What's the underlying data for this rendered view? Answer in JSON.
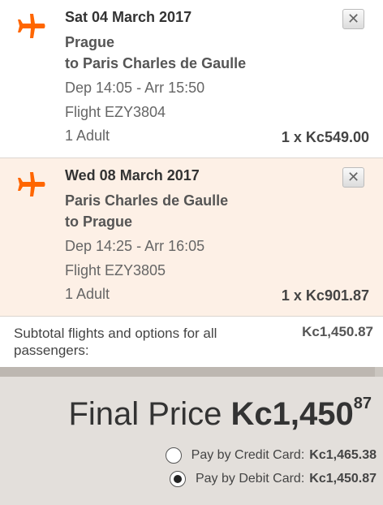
{
  "accent_color": "#ff6600",
  "flights": [
    {
      "date": "Sat 04 March 2017",
      "from": "Prague",
      "to": "to Paris Charles de Gaulle",
      "times": "Dep 14:05 - Arr 15:50",
      "flight_no": "Flight EZY3804",
      "passengers": "1 Adult",
      "price": "1 x Kc549.00",
      "remove_label": "✕",
      "icon": "plane-icon"
    },
    {
      "date": "Wed 08 March 2017",
      "from": "Paris Charles de Gaulle",
      "to": "to Prague",
      "times": "Dep 14:25 - Arr 16:05",
      "flight_no": "Flight EZY3805",
      "passengers": "1 Adult",
      "price": "1 x Kc901.87",
      "remove_label": "✕",
      "icon": "plane-icon"
    }
  ],
  "subtotal": {
    "label": "Subtotal flights and options for all passengers:",
    "value": "Kc1,450.87"
  },
  "final_price": {
    "label": "Final Price",
    "amount": "Kc1,450",
    "cents": "87"
  },
  "payment": {
    "credit": {
      "label": "Pay by Credit Card:",
      "amount": "Kc1,465.38",
      "selected": false
    },
    "debit": {
      "label": "Pay by Debit Card:",
      "amount": "Kc1,450.87",
      "selected": true
    }
  }
}
